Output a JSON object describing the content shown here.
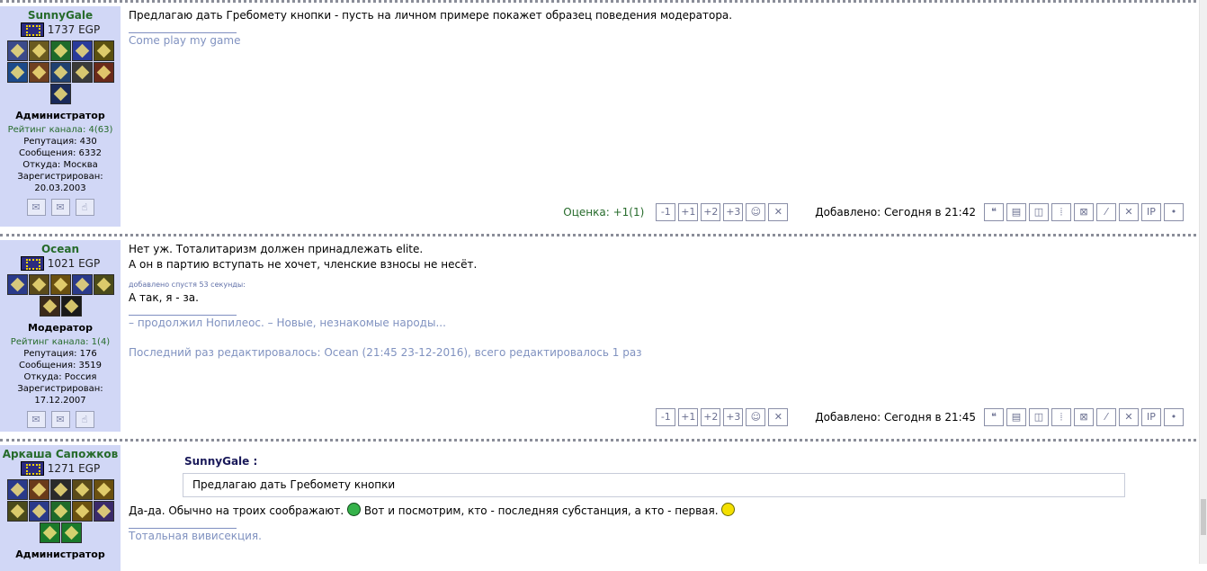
{
  "posts": [
    {
      "user": {
        "name": "SunnyGale",
        "egp": "1737 EGP",
        "role": "Администратор",
        "rating": "Рейтинг канала: 4(63)",
        "reputation": "Репутация: 430",
        "messages": "Сообщения: 6332",
        "from": "Откуда: Москва",
        "registered_label": "Зарегистрирован:",
        "registered": "20.03.2003"
      },
      "text": [
        "Предлагаю дать Гребомету кнопки - пусть на личном примере покажет образец поведения модератора."
      ],
      "signature": "Come play my game",
      "score_label": "Оценка:",
      "score": "+1(1)",
      "added": "Добавлено: Сегодня в 21:42"
    },
    {
      "user": {
        "name": "Ocean",
        "egp": "1021 EGP",
        "role": "Модератор",
        "rating": "Рейтинг канала: 1(4)",
        "reputation": "Репутация: 176",
        "messages": "Сообщения: 3519",
        "from": "Откуда: Россия",
        "registered_label": "Зарегистрирован:",
        "registered": "17.12.2007"
      },
      "text": [
        "Нет уж. Тоталитаризм должен принадлежать elite.",
        "А он в партию вступать не хочет, членские взносы не несёт."
      ],
      "added_note": "добавлено спустя 53 секунды:",
      "text2": "А так, я - за.",
      "signature": "– продолжил Нопилеос. – Новые, незнакомые народы...",
      "edited": "Последний раз редактировалось: Ocean (21:45 23-12-2016), всего редактировалось 1 раз",
      "added": "Добавлено: Сегодня в 21:45"
    },
    {
      "user": {
        "name": "Аркаша Сапожков",
        "egp": "1271 EGP",
        "role": "Администратор"
      },
      "quote_author": "SunnyGale :",
      "quote": "Предлагаю дать Гребомету кнопки",
      "text_a": "Да-да. Обычно на троих соображают.",
      "text_b": "Вот и посмотрим, кто - последняя субстанция, а кто - первая.",
      "signature": "Тотальная вивисекция."
    }
  ],
  "vote_buttons": [
    "-1",
    "+1",
    "+2",
    "+3",
    "☺",
    "✕"
  ],
  "action_buttons": [
    "quote-icon",
    "edit-icon",
    "box-icon",
    "bars-icon",
    "hide-icon",
    "translit-icon",
    "delete-icon",
    "IP",
    "•"
  ],
  "colors": {
    "sidebar": "#d1d7f6",
    "username": "#266b2b",
    "signature": "#8092c0"
  }
}
